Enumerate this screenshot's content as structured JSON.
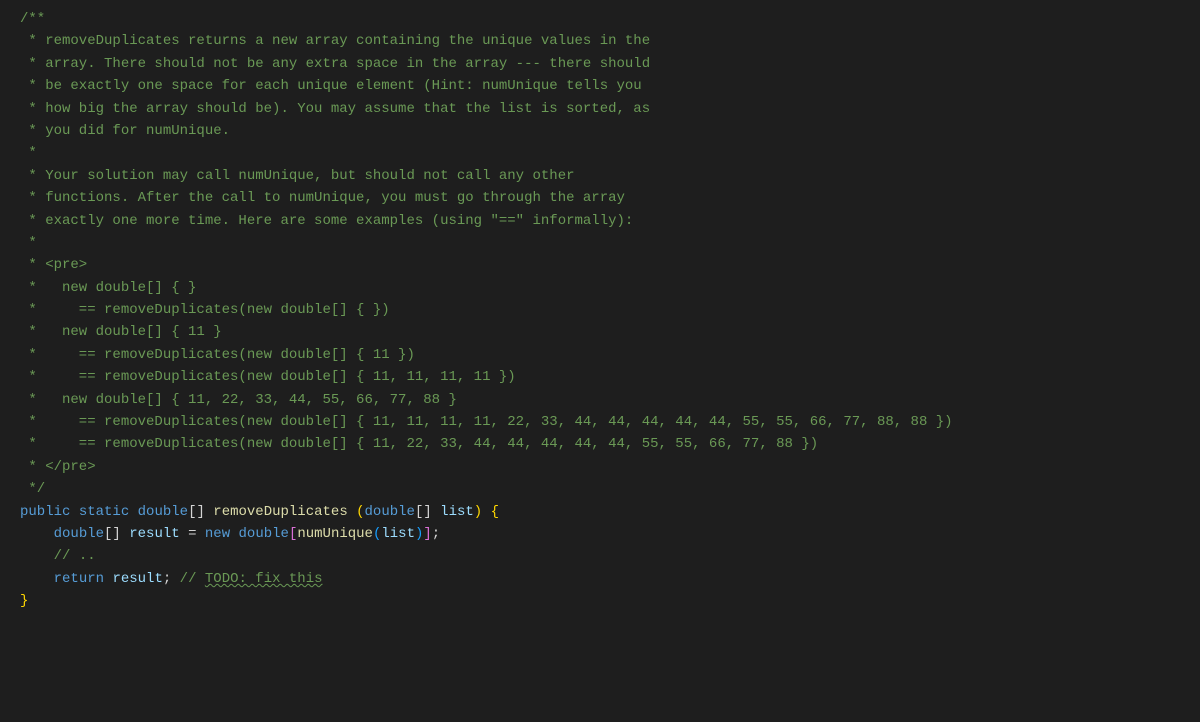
{
  "code": {
    "lines": [
      {
        "indent": 1,
        "segments": [
          {
            "text": "/**",
            "cls": "javadoc"
          }
        ]
      },
      {
        "indent": 1,
        "segments": [
          {
            "text": " * removeDuplicates returns a new array containing the unique values in the",
            "cls": "javadoc"
          }
        ]
      },
      {
        "indent": 1,
        "segments": [
          {
            "text": " * array. There should not be any extra space in the array --- there should",
            "cls": "javadoc"
          }
        ]
      },
      {
        "indent": 1,
        "segments": [
          {
            "text": " * be exactly one space for each unique element (Hint: numUnique tells you",
            "cls": "javadoc"
          }
        ]
      },
      {
        "indent": 1,
        "segments": [
          {
            "text": " * how big the array should be). You may assume that the list is sorted, as",
            "cls": "javadoc"
          }
        ]
      },
      {
        "indent": 1,
        "segments": [
          {
            "text": " * you did for numUnique.",
            "cls": "javadoc"
          }
        ]
      },
      {
        "indent": 1,
        "segments": [
          {
            "text": " *",
            "cls": "javadoc"
          }
        ]
      },
      {
        "indent": 1,
        "segments": [
          {
            "text": " * Your solution may call numUnique, but should not call any other",
            "cls": "javadoc"
          }
        ]
      },
      {
        "indent": 1,
        "segments": [
          {
            "text": " * functions. After the call to numUnique, you must go through the array",
            "cls": "javadoc"
          }
        ]
      },
      {
        "indent": 1,
        "segments": [
          {
            "text": " * exactly one more time. Here are some examples (using \"==\" informally):",
            "cls": "javadoc"
          }
        ]
      },
      {
        "indent": 1,
        "segments": [
          {
            "text": " *",
            "cls": "javadoc"
          }
        ]
      },
      {
        "indent": 1,
        "segments": [
          {
            "text": " * <pre>",
            "cls": "javadoc"
          }
        ]
      },
      {
        "indent": 1,
        "segments": [
          {
            "text": " *   new double[] { }",
            "cls": "javadoc"
          }
        ]
      },
      {
        "indent": 1,
        "segments": [
          {
            "text": " *     == removeDuplicates(new double[] { })",
            "cls": "javadoc"
          }
        ]
      },
      {
        "indent": 1,
        "segments": [
          {
            "text": " *   new double[] { 11 }",
            "cls": "javadoc"
          }
        ]
      },
      {
        "indent": 1,
        "segments": [
          {
            "text": " *     == removeDuplicates(new double[] { 11 })",
            "cls": "javadoc"
          }
        ]
      },
      {
        "indent": 1,
        "segments": [
          {
            "text": " *     == removeDuplicates(new double[] { 11, 11, 11, 11 })",
            "cls": "javadoc"
          }
        ]
      },
      {
        "indent": 1,
        "segments": [
          {
            "text": " *   new double[] { 11, 22, 33, 44, 55, 66, 77, 88 }",
            "cls": "javadoc"
          }
        ]
      },
      {
        "indent": 1,
        "segments": [
          {
            "text": " *     == removeDuplicates(new double[] { 11, 11, 11, 11, 22, 33, 44, 44, 44, 44, 44, 55, 55, 66, 77, 88, 88 })",
            "cls": "javadoc"
          }
        ]
      },
      {
        "indent": 1,
        "segments": [
          {
            "text": " *     == removeDuplicates(new double[] { 11, 22, 33, 44, 44, 44, 44, 44, 55, 55, 66, 77, 88 })",
            "cls": "javadoc"
          }
        ]
      },
      {
        "indent": 1,
        "segments": [
          {
            "text": " * </pre>",
            "cls": "javadoc"
          }
        ]
      },
      {
        "indent": 1,
        "segments": [
          {
            "text": " */",
            "cls": "javadoc"
          }
        ]
      },
      {
        "indent": 1,
        "segments": [
          {
            "text": "public",
            "cls": "keyword"
          },
          {
            "text": " ",
            "cls": ""
          },
          {
            "text": "static",
            "cls": "keyword"
          },
          {
            "text": " ",
            "cls": ""
          },
          {
            "text": "double",
            "cls": "type"
          },
          {
            "text": "[] ",
            "cls": "bracket"
          },
          {
            "text": "removeDuplicates",
            "cls": "method-name"
          },
          {
            "text": " ",
            "cls": ""
          },
          {
            "text": "(",
            "cls": "bracket-gold"
          },
          {
            "text": "double",
            "cls": "type"
          },
          {
            "text": "[] ",
            "cls": "bracket"
          },
          {
            "text": "list",
            "cls": "variable"
          },
          {
            "text": ")",
            "cls": "bracket-gold"
          },
          {
            "text": " ",
            "cls": ""
          },
          {
            "text": "{",
            "cls": "bracket-gold"
          }
        ]
      },
      {
        "indent": 2,
        "segments": [
          {
            "text": "double",
            "cls": "type"
          },
          {
            "text": "[] ",
            "cls": "bracket"
          },
          {
            "text": "result",
            "cls": "variable"
          },
          {
            "text": " = ",
            "cls": "operator"
          },
          {
            "text": "new",
            "cls": "keyword"
          },
          {
            "text": " ",
            "cls": ""
          },
          {
            "text": "double",
            "cls": "type"
          },
          {
            "text": "[",
            "cls": "bracket-pink"
          },
          {
            "text": "numUnique",
            "cls": "method-name"
          },
          {
            "text": "(",
            "cls": "bracket-blue"
          },
          {
            "text": "list",
            "cls": "variable"
          },
          {
            "text": ")",
            "cls": "bracket-blue"
          },
          {
            "text": "]",
            "cls": "bracket-pink"
          },
          {
            "text": ";",
            "cls": "punctuation"
          }
        ]
      },
      {
        "indent": 2,
        "segments": [
          {
            "text": "// ..",
            "cls": "comment"
          }
        ]
      },
      {
        "indent": 2,
        "segments": [
          {
            "text": "return",
            "cls": "keyword"
          },
          {
            "text": " ",
            "cls": ""
          },
          {
            "text": "result",
            "cls": "variable"
          },
          {
            "text": "; ",
            "cls": "punctuation"
          },
          {
            "text": "// ",
            "cls": "comment"
          },
          {
            "text": "TODO: fix this",
            "cls": "comment todo-squiggle"
          }
        ]
      },
      {
        "indent": 1,
        "segments": [
          {
            "text": "}",
            "cls": "bracket-gold"
          }
        ]
      }
    ]
  }
}
